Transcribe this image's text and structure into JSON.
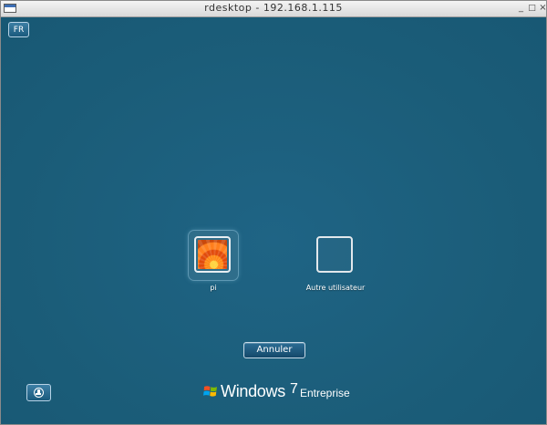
{
  "window": {
    "title": "rdesktop - 192.168.1.115",
    "controls": {
      "minimize": "_",
      "maximize": "□",
      "close": "×"
    }
  },
  "logon": {
    "language_button": "FR",
    "users": [
      {
        "name": "pi",
        "picture_icon": "flower-picture",
        "selected": true
      },
      {
        "name": "Autre utilisateur",
        "picture_icon": "blank-user-picture",
        "selected": false
      }
    ],
    "cancel_button": "Annuler",
    "ease_of_access_icon": "ease-of-access-icon"
  },
  "branding": {
    "product": "Windows",
    "version": "7",
    "edition": "Entreprise",
    "logo_icon": "windows-flag-icon"
  },
  "colors": {
    "background": "#1b5d79",
    "titlebar": "#e6e6e6",
    "text": "#ffffff"
  }
}
